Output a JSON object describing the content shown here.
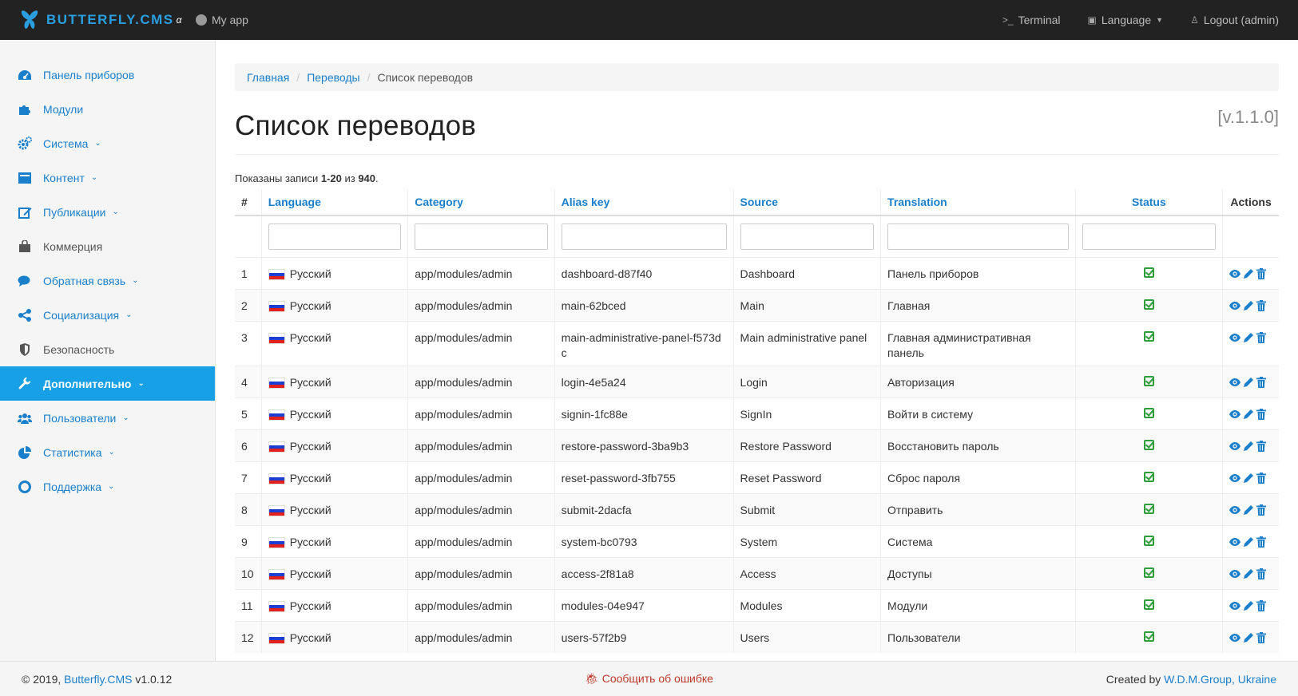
{
  "navbar": {
    "brand": "BUTTERFLY.CMS",
    "brand_sup": "α",
    "app_link": "My app",
    "terminal": "Terminal",
    "language": "Language",
    "logout": "Logout (admin)",
    "accent": "#2a9fe0"
  },
  "sidebar": {
    "items": [
      {
        "label": "Панель приборов",
        "icon": "dashboard-icon"
      },
      {
        "label": "Модули",
        "icon": "puzzle-icon"
      },
      {
        "label": "Система",
        "icon": "cogs-icon"
      },
      {
        "label": "Контент",
        "icon": "content-icon"
      },
      {
        "label": "Публикации",
        "icon": "edit-icon"
      },
      {
        "label": "Коммерция",
        "icon": "shopping-bag-icon"
      },
      {
        "label": "Обратная связь",
        "icon": "comments-icon"
      },
      {
        "label": "Социализация",
        "icon": "share-icon"
      },
      {
        "label": "Безопасность",
        "icon": "shield-icon"
      },
      {
        "label": "Дополнительно",
        "icon": "wrench-icon"
      },
      {
        "label": "Пользователи",
        "icon": "users-icon"
      },
      {
        "label": "Статистика",
        "icon": "pie-chart-icon"
      },
      {
        "label": "Поддержка",
        "icon": "life-ring-icon"
      }
    ]
  },
  "breadcrumb": {
    "home": "Главная",
    "translations": "Переводы",
    "current": "Список переводов"
  },
  "page": {
    "title": "Список переводов",
    "version": "[v.1.1.0]",
    "summary_prefix": "Показаны записи ",
    "summary_range": "1-20",
    "summary_mid": " из ",
    "summary_total": "940",
    "summary_end": "."
  },
  "table": {
    "columns": {
      "num": "#",
      "language": "Language",
      "category": "Category",
      "alias": "Alias key",
      "source": "Source",
      "translation": "Translation",
      "status": "Status",
      "actions": "Actions"
    },
    "rows": [
      {
        "n": "1",
        "lang": "Русский",
        "cat": "app/modules/admin",
        "alias": "dashboard-d87f40",
        "source": "Dashboard",
        "tr": "Панель приборов"
      },
      {
        "n": "2",
        "lang": "Русский",
        "cat": "app/modules/admin",
        "alias": "main-62bced",
        "source": "Main",
        "tr": "Главная"
      },
      {
        "n": "3",
        "lang": "Русский",
        "cat": "app/modules/admin",
        "alias": "main-administrative-panel-f573dc",
        "source": "Main administrative panel",
        "tr": "Главная административная панель"
      },
      {
        "n": "4",
        "lang": "Русский",
        "cat": "app/modules/admin",
        "alias": "login-4e5a24",
        "source": "Login",
        "tr": "Авторизация"
      },
      {
        "n": "5",
        "lang": "Русский",
        "cat": "app/modules/admin",
        "alias": "signin-1fc88e",
        "source": "SignIn",
        "tr": "Войти в систему"
      },
      {
        "n": "6",
        "lang": "Русский",
        "cat": "app/modules/admin",
        "alias": "restore-password-3ba9b3",
        "source": "Restore Password",
        "tr": "Восстановить пароль"
      },
      {
        "n": "7",
        "lang": "Русский",
        "cat": "app/modules/admin",
        "alias": "reset-password-3fb755",
        "source": "Reset Password",
        "tr": "Сброс пароля"
      },
      {
        "n": "8",
        "lang": "Русский",
        "cat": "app/modules/admin",
        "alias": "submit-2dacfa",
        "source": "Submit",
        "tr": "Отправить"
      },
      {
        "n": "9",
        "lang": "Русский",
        "cat": "app/modules/admin",
        "alias": "system-bc0793",
        "source": "System",
        "tr": "Система"
      },
      {
        "n": "10",
        "lang": "Русский",
        "cat": "app/modules/admin",
        "alias": "access-2f81a8",
        "source": "Access",
        "tr": "Доступы"
      },
      {
        "n": "11",
        "lang": "Русский",
        "cat": "app/modules/admin",
        "alias": "modules-04e947",
        "source": "Modules",
        "tr": "Модули"
      },
      {
        "n": "12",
        "lang": "Русский",
        "cat": "app/modules/admin",
        "alias": "users-57f2b9",
        "source": "Users",
        "tr": "Пользователи"
      }
    ]
  },
  "footer": {
    "copyright": "© 2019, ",
    "cms_link": "Butterfly.CMS",
    "version": " v1.0.12",
    "report": "Сообщить об ошибке",
    "created_by": "Created by ",
    "company": "W.D.M.Group, Ukraine"
  }
}
